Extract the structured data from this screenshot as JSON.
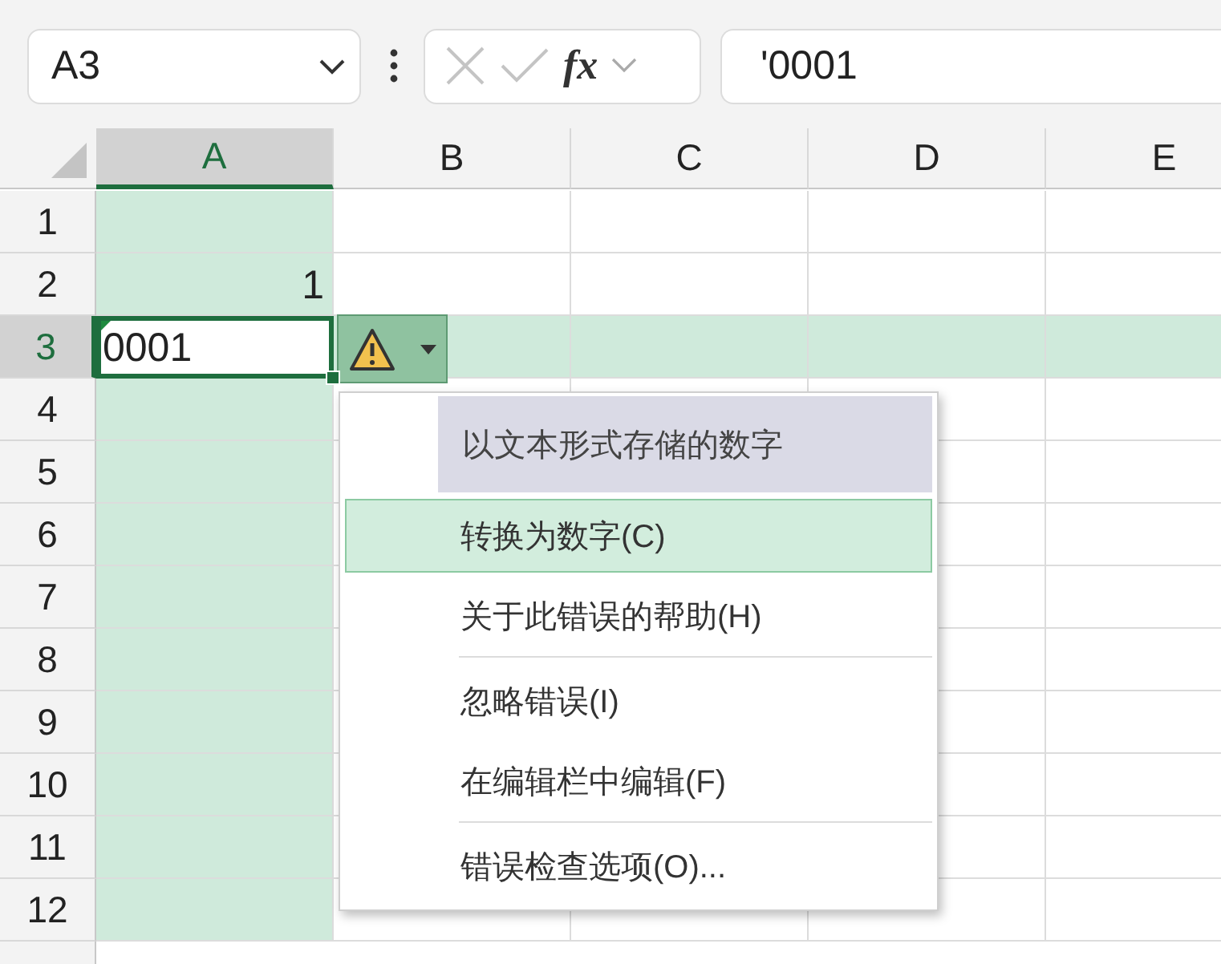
{
  "name_box": {
    "value": "A3"
  },
  "formula_bar": {
    "function_label": "fx",
    "value": "'0001"
  },
  "columns": [
    {
      "label": "A",
      "selected": true
    },
    {
      "label": "B",
      "selected": false
    },
    {
      "label": "C",
      "selected": false
    },
    {
      "label": "D",
      "selected": false
    },
    {
      "label": "E",
      "selected": false
    }
  ],
  "rows": [
    {
      "label": "1",
      "selected": false,
      "cells": []
    },
    {
      "label": "2",
      "selected": false,
      "cells": [
        {
          "value": "1",
          "kind": "number",
          "active": false
        }
      ]
    },
    {
      "label": "3",
      "selected": true,
      "cells": [
        {
          "value": "0001",
          "kind": "text",
          "active": true
        }
      ]
    },
    {
      "label": "4",
      "selected": false,
      "cells": []
    },
    {
      "label": "5",
      "selected": false,
      "cells": []
    },
    {
      "label": "6",
      "selected": false,
      "cells": []
    },
    {
      "label": "7",
      "selected": false,
      "cells": []
    },
    {
      "label": "8",
      "selected": false,
      "cells": []
    },
    {
      "label": "9",
      "selected": false,
      "cells": []
    },
    {
      "label": "10",
      "selected": false,
      "cells": []
    },
    {
      "label": "11",
      "selected": false,
      "cells": []
    },
    {
      "label": "12",
      "selected": false,
      "cells": []
    }
  ],
  "error_menu": {
    "title": "以文本形式存储的数字",
    "items": [
      {
        "label": "转换为数字(C)",
        "selected": true,
        "separator_after": false
      },
      {
        "label": "关于此错误的帮助(H)",
        "selected": false,
        "separator_after": true
      },
      {
        "label": "忽略错误(I)",
        "selected": false,
        "separator_after": false
      },
      {
        "label": "在编辑栏中编辑(F)",
        "selected": false,
        "separator_after": true
      },
      {
        "label": "错误检查选项(O)...",
        "selected": false,
        "separator_after": false
      }
    ]
  }
}
